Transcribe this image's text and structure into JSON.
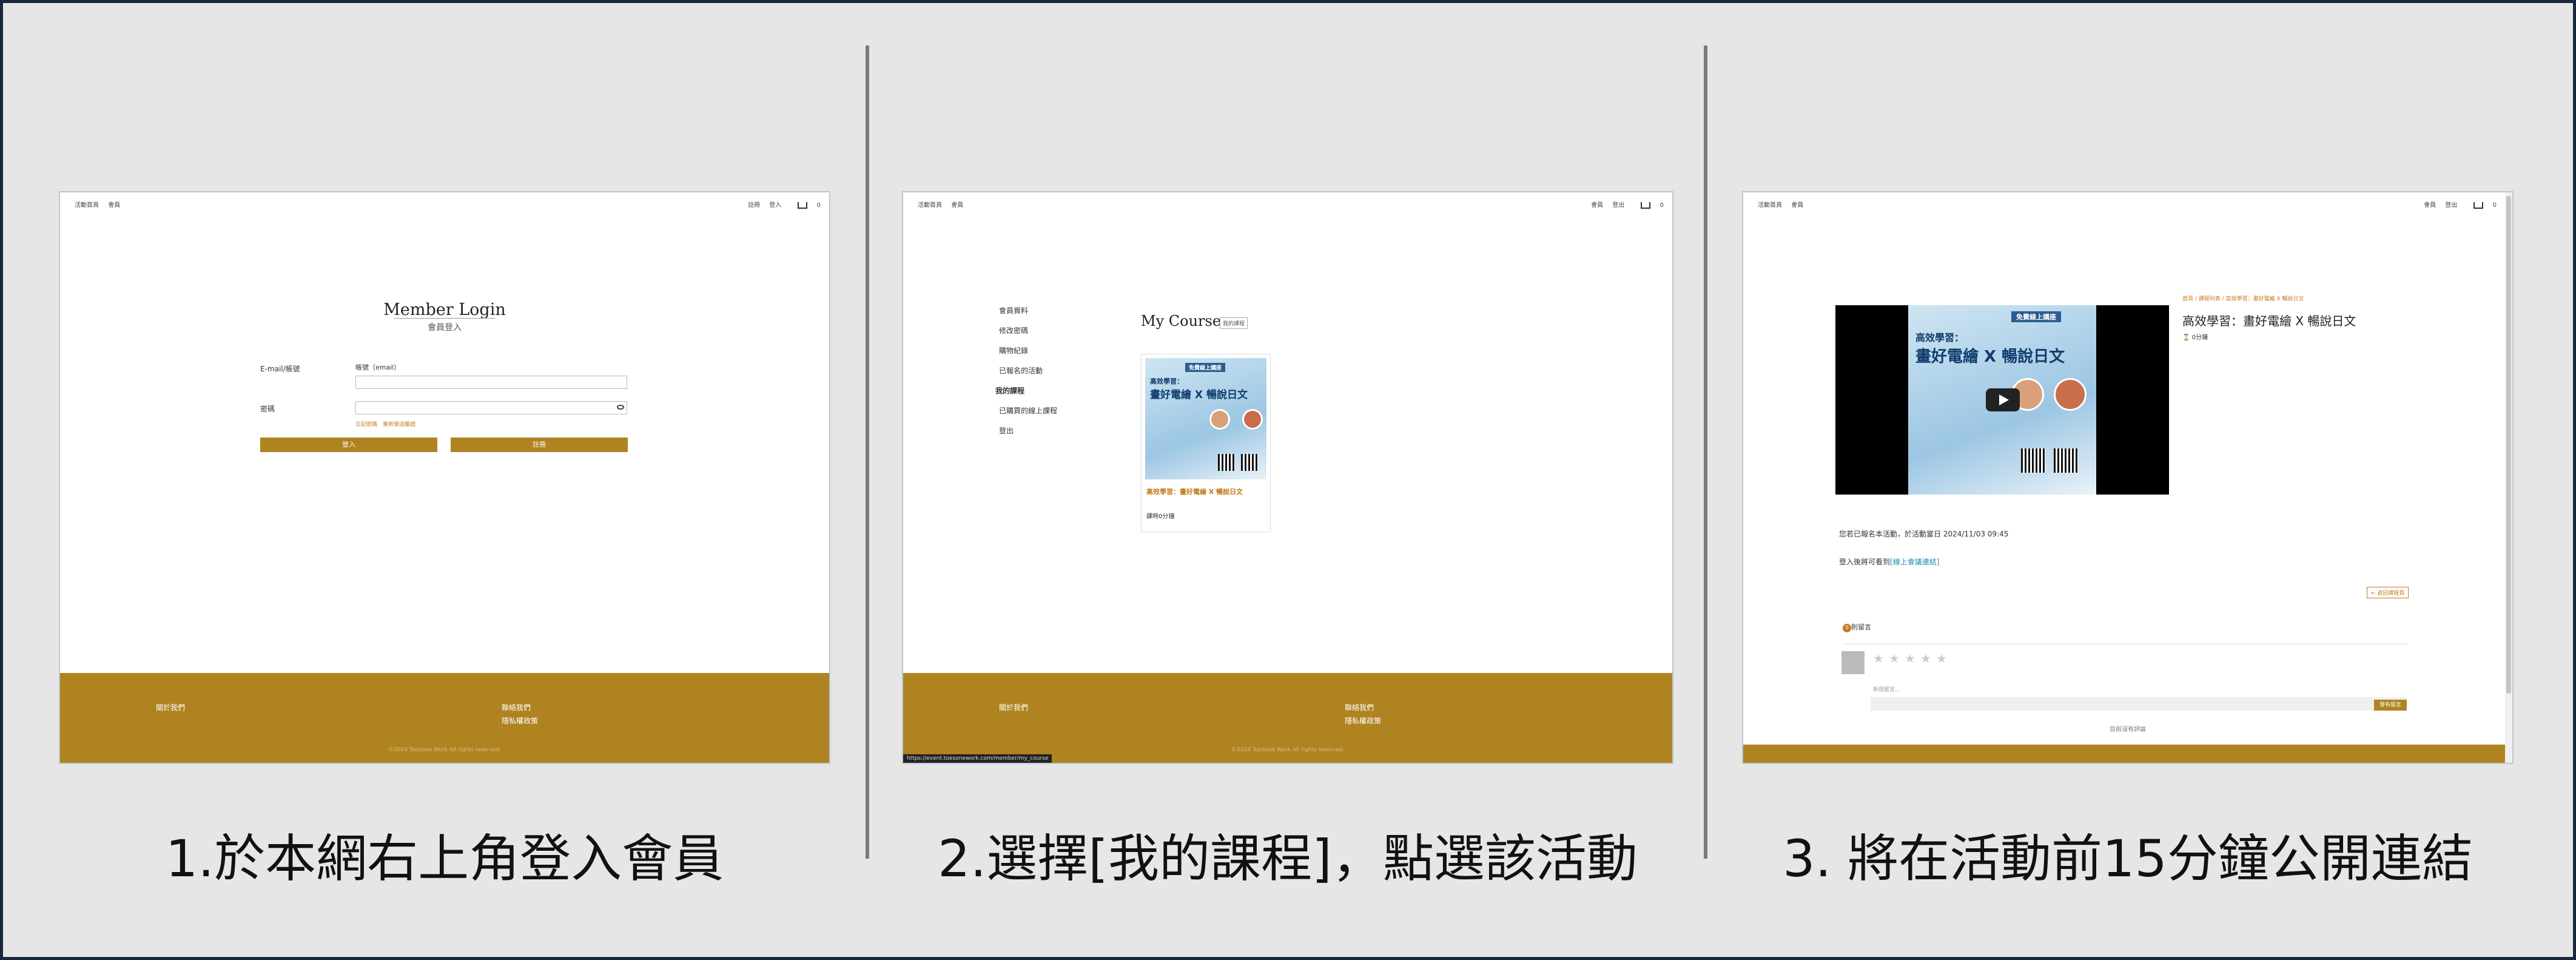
{
  "site": {
    "nav_left": [
      "活動首頁",
      "會員"
    ],
    "cart_count": "0"
  },
  "panel1": {
    "nav_right": [
      "註冊",
      "登入"
    ],
    "title": "Member Login",
    "subtitle": "會員登入",
    "email_label": "E-mail/帳號",
    "email_hint": "帳號（email）",
    "password_label": "密碼",
    "forgot": "忘記密碼　重新發送驗證",
    "login_btn": "登入",
    "register_btn": "註冊"
  },
  "panel2": {
    "nav_right": [
      "會員",
      "登出"
    ],
    "menu": [
      "會員資料",
      "修改密碼",
      "購物紀錄",
      "已報名的活動",
      "我的課程",
      "已購買的線上課程",
      "登出"
    ],
    "heading": "My Course",
    "tag": "我的課程",
    "poster": {
      "top": "免費線上講座",
      "line1": "高效學習：",
      "line2": "畫好電繪 X 暢說日文"
    },
    "course_title": "高效學習：畫好電繪 X 暢說日文",
    "duration": "課時0分鐘",
    "status_url": "https://event.toesonework.com/member/my_course"
  },
  "panel3": {
    "nav_right": [
      "會員",
      "登出"
    ],
    "breadcrumb": "首頁 / 課程列表 / 高效學習：畫好電繪 X 暢說日文",
    "title": "高效學習：畫好電繪 X 暢說日文",
    "duration": "0分鐘",
    "poster": {
      "top": "免費線上講座",
      "line1": "高效學習：",
      "line2": "畫好電繪 X 暢說日文"
    },
    "notice": "您若已報名本活動，於活動當日 2024/11/03 09:45",
    "link_prefix": "登入後將可看到",
    "link_text": "[線上會議連結]",
    "back_btn": "← 返回課程頁",
    "comments_label": "則留言",
    "comments_count": "0",
    "comment_placeholder": "新增留言...",
    "send_btn": "發布留言",
    "no_comments": "目前沒有評論"
  },
  "footer": {
    "about": "關於我們",
    "contact": "聯絡我們",
    "privacy": "隱私權政策",
    "copyright": "©2024 ToeSone Work All rights reserved."
  },
  "captions": {
    "step1": "1.於本網右上角登入會員",
    "step2": "2.選擇[我的課程]，點選該活動",
    "step3": "3. 將在活動前15分鐘公開連結"
  },
  "colors": {
    "brand": "#af8320",
    "frame": "#16283a",
    "bg": "#e6e6e6"
  }
}
